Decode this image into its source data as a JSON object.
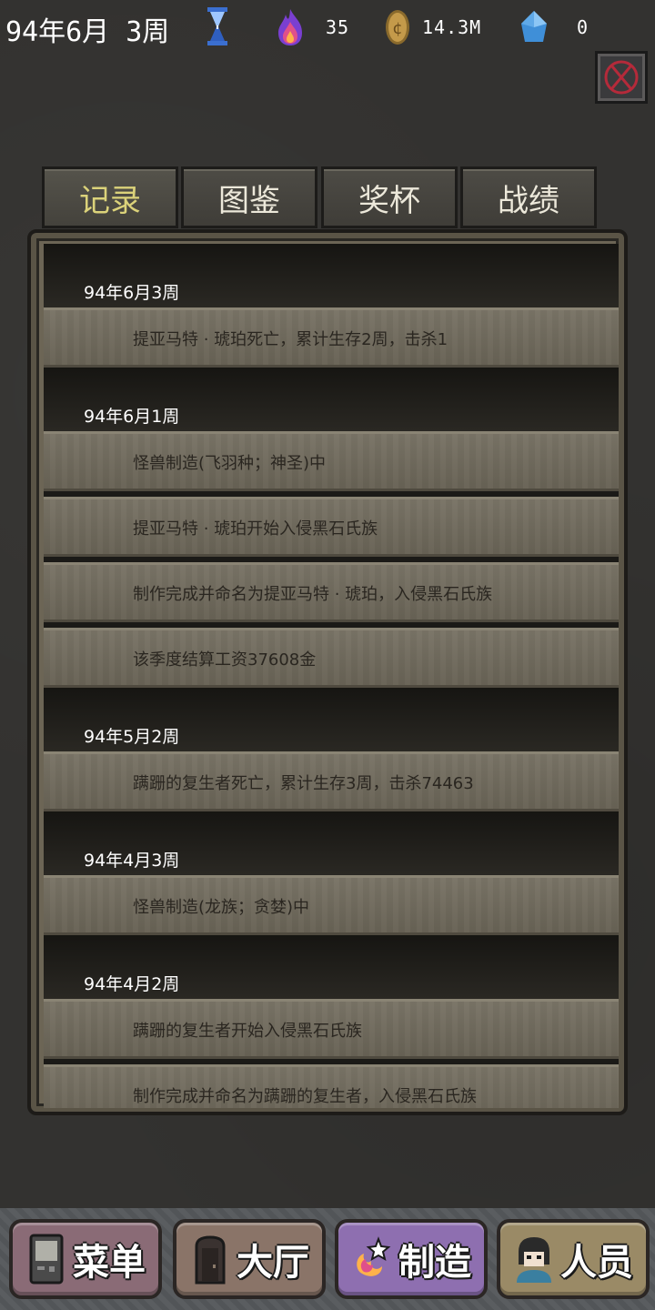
{
  "status": {
    "date": "94年6月 3周",
    "energy": "35",
    "gold": "14.3M",
    "gems": "0"
  },
  "tabs": [
    {
      "label": "记录",
      "active": true
    },
    {
      "label": "图鉴",
      "active": false
    },
    {
      "label": "奖杯",
      "active": false
    },
    {
      "label": "战绩",
      "active": false
    }
  ],
  "log": [
    {
      "date": "94年6月3周",
      "entries": [
        "提亚马特 · 琥珀死亡，累计生存2周，击杀1"
      ]
    },
    {
      "date": "94年6月1周",
      "entries": [
        "怪兽制造(飞羽种；神圣)中",
        "提亚马特 · 琥珀开始入侵黑石氏族",
        "制作完成并命名为提亚马特 · 琥珀，入侵黑石氏族",
        "该季度结算工资37608金"
      ]
    },
    {
      "date": "94年5月2周",
      "entries": [
        "蹒跚的复生者死亡，累计生存3周，击杀74463"
      ]
    },
    {
      "date": "94年4月3周",
      "entries": [
        "怪兽制造(龙族；贪婪)中"
      ]
    },
    {
      "date": "94年4月2周",
      "entries": [
        "蹒跚的复生者开始入侵黑石氏族",
        "制作完成并命名为蹒跚的复生者，入侵黑石氏族"
      ]
    }
  ],
  "nav": {
    "menu": "菜单",
    "hall": "大厅",
    "craft": "制造",
    "staff": "人员"
  },
  "colors": {
    "active_tab": "#dbd27a",
    "background": "#333230",
    "entry_bg": "#716b5d"
  }
}
